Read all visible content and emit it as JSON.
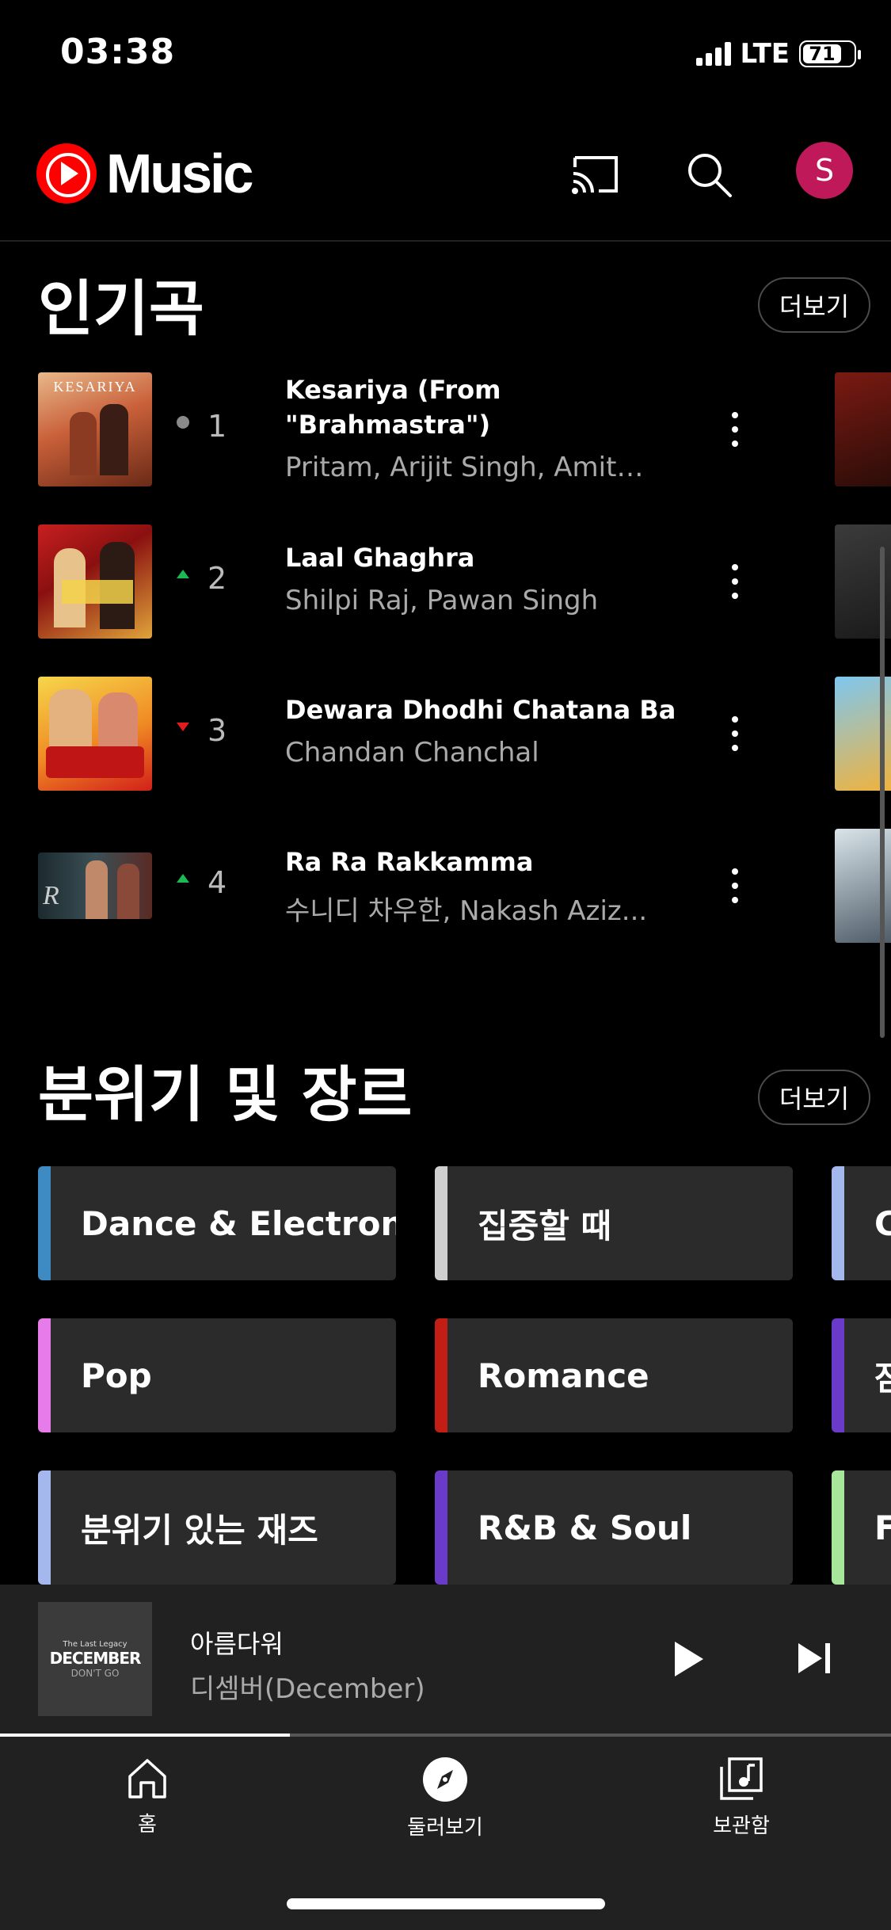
{
  "status": {
    "time": "03:38",
    "network": "LTE",
    "battery": "71"
  },
  "header": {
    "app_name": "Music",
    "avatar_initial": "S"
  },
  "charts": {
    "title": "인기곡",
    "more_label": "더보기",
    "tracks": [
      {
        "rank": "1",
        "title_line1": "Kesariya (From",
        "title_line2": "\"Brahmastra\")",
        "artist": "Pritam, Arijit Singh, Amita...",
        "trend": "same"
      },
      {
        "rank": "2",
        "title_line1": "Laal Ghaghra",
        "title_line2": "",
        "artist": "Shilpi Raj, Pawan Singh",
        "trend": "up"
      },
      {
        "rank": "3",
        "title_line1": "Dewara Dhodhi Chatana Ba",
        "title_line2": "",
        "artist": "Chandan Chanchal",
        "trend": "down"
      },
      {
        "rank": "4",
        "title_line1": "Ra Ra Rakkamma",
        "title_line2": "",
        "artist": "수니디 차우한, Nakash Aziz...",
        "trend": "up"
      }
    ],
    "cover_text_1": "KESARIYA"
  },
  "genres": {
    "title": "분위기 및 장르",
    "more_label": "더보기",
    "items": [
      {
        "label": "Dance & Electronic",
        "color": "#3d8bc2"
      },
      {
        "label": "집중할 때",
        "color": "#cfcfcf"
      },
      {
        "label": "C",
        "color": "#a5b8ee"
      },
      {
        "label": "Pop",
        "color": "#e77bea"
      },
      {
        "label": "Romance",
        "color": "#c21e16"
      },
      {
        "label": "잠",
        "color": "#6a3ac8"
      },
      {
        "label": "분위기 있는 재즈",
        "color": "#a5b8ee"
      },
      {
        "label": "R&B & Soul",
        "color": "#6a3ac8"
      },
      {
        "label": "F",
        "color": "#a8e79b"
      }
    ]
  },
  "player": {
    "title": "아름다워",
    "artist": "디셈버(December)",
    "cover_small": "The Last Legacy",
    "cover_big": "DECEMBER",
    "cover_sub": "DON'T GO"
  },
  "nav": {
    "items": [
      {
        "label": "홈"
      },
      {
        "label": "둘러보기"
      },
      {
        "label": "보관함"
      }
    ]
  }
}
